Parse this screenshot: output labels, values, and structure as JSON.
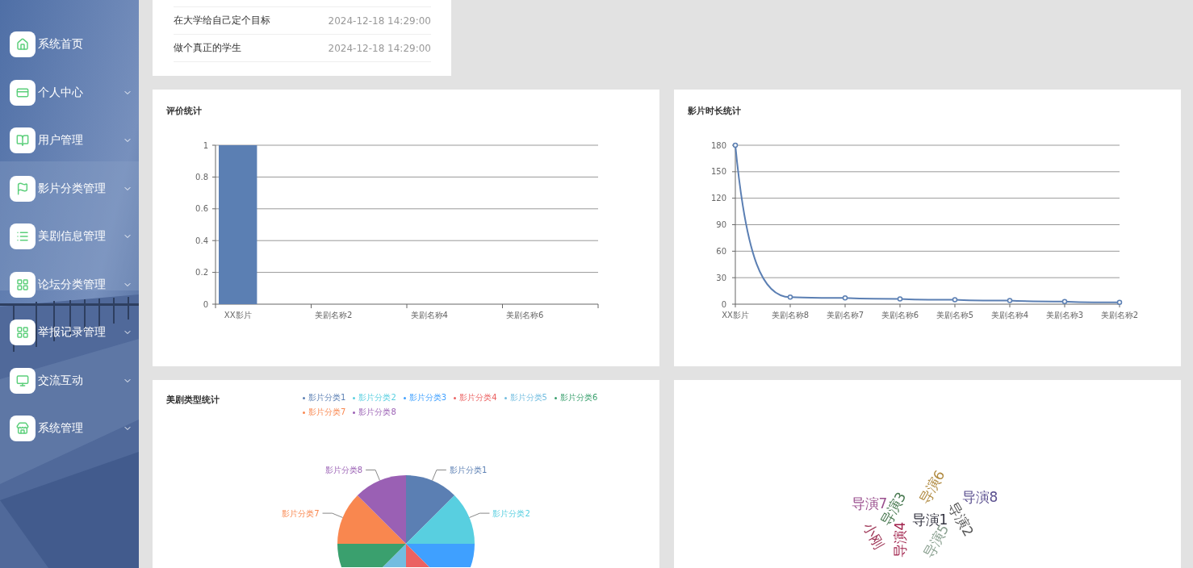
{
  "sidebar": {
    "items": [
      {
        "label": "系统首页",
        "has_submenu": false
      },
      {
        "label": "个人中心",
        "has_submenu": true
      },
      {
        "label": "用户管理",
        "has_submenu": true
      },
      {
        "label": "影片分类管理",
        "has_submenu": true
      },
      {
        "label": "美剧信息管理",
        "has_submenu": true
      },
      {
        "label": "论坛分类管理",
        "has_submenu": true
      },
      {
        "label": "举报记录管理",
        "has_submenu": true
      },
      {
        "label": "交流互动",
        "has_submenu": true
      },
      {
        "label": "系统管理",
        "has_submenu": true
      }
    ]
  },
  "notice_list": [
    {
      "title": "在大学给自己定个目标",
      "time": "2024-12-18 14:29:00"
    },
    {
      "title": "做个真正的学生",
      "time": "2024-12-18 14:29:00"
    }
  ],
  "rating_chart": {
    "title": "评价统计",
    "chart_data": {
      "type": "bar",
      "categories": [
        "XX影片",
        "美剧名称2",
        "美剧名称4",
        "美剧名称6"
      ],
      "series": [
        {
          "color": "#5b7fb3",
          "values": [
            1,
            0,
            0,
            0
          ]
        }
      ],
      "grid": true,
      "ylim": [
        0,
        1
      ],
      "yticks": [
        0,
        0.2,
        0.4,
        0.6,
        0.8,
        1
      ]
    }
  },
  "duration_chart": {
    "title": "影片时长统计",
    "chart_data": {
      "type": "line",
      "categories": [
        "XX影片",
        "美剧名称8",
        "美剧名称7",
        "美剧名称6",
        "美剧名称5",
        "美剧名称4",
        "美剧名称3",
        "美剧名称2"
      ],
      "series": [
        {
          "color": "#5b7fb3",
          "values": [
            180,
            8,
            7,
            6,
            5,
            4,
            3,
            2
          ],
          "marker": true
        }
      ],
      "grid": true,
      "ylim": [
        0,
        180
      ],
      "yticks": [
        0,
        30,
        60,
        90,
        120,
        150,
        180
      ]
    }
  },
  "type_chart": {
    "title": "美剧类型统计",
    "chart_data": {
      "type": "pie",
      "categories": [
        "影片分类1",
        "影片分类2",
        "影片分类3",
        "影片分类4",
        "影片分类5",
        "影片分类6",
        "影片分类7",
        "影片分类8"
      ],
      "series": [
        {
          "values": [
            1,
            1,
            1,
            1,
            1,
            1,
            1,
            1
          ]
        }
      ],
      "colors": [
        "#5b7fb3",
        "#58cfe0",
        "#3fa0ff",
        "#eb6262",
        "#72bde0",
        "#3aa06e",
        "#f9874f",
        "#9a60b4"
      ]
    }
  },
  "word_cloud": {
    "words": [
      {
        "text": "导演7",
        "color": "#9a4f8e"
      },
      {
        "text": "导演3",
        "color": "#4a7a52"
      },
      {
        "text": "导演6",
        "color": "#b08a40"
      },
      {
        "text": "导演8",
        "color": "#5a4f8f"
      },
      {
        "text": "导演1",
        "color": "#333340"
      },
      {
        "text": "导演2",
        "color": "#555555"
      },
      {
        "text": "小刚",
        "color": "#a03a5a"
      },
      {
        "text": "导演4",
        "color": "#a0204a"
      },
      {
        "text": "导演5",
        "color": "#8aa090"
      }
    ]
  }
}
